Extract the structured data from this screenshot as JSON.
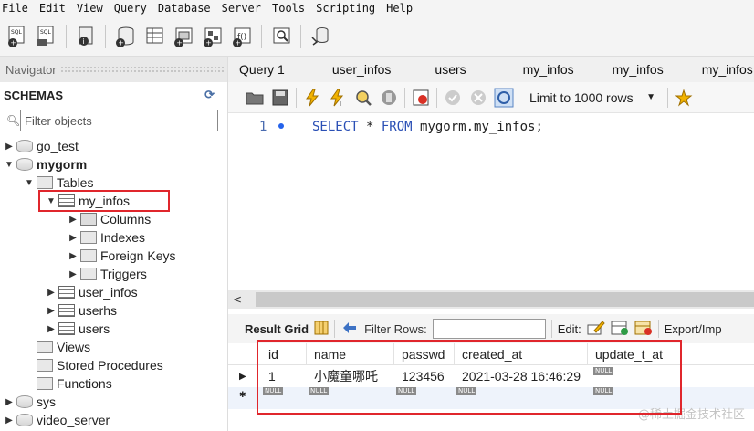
{
  "menu": [
    "File",
    "Edit",
    "View",
    "Query",
    "Database",
    "Server",
    "Tools",
    "Scripting",
    "Help"
  ],
  "toolbar_icons": [
    "new-sql-tab-icon",
    "open-sql-file-icon",
    "info-icon",
    "create-schema-icon",
    "create-table-icon",
    "create-view-icon",
    "create-procedure-icon",
    "create-function-icon",
    "search-table-data-icon",
    "reconnect-icon"
  ],
  "navigator": {
    "title": "Navigator",
    "schemas_label": "SCHEMAS",
    "filter_placeholder": "Filter objects",
    "tree": {
      "go_test": "go_test",
      "mygorm": "mygorm",
      "tables": "Tables",
      "my_infos": "my_infos",
      "columns": "Columns",
      "indexes": "Indexes",
      "foreign_keys": "Foreign Keys",
      "triggers": "Triggers",
      "user_infos": "user_infos",
      "userhs": "userhs",
      "users": "users",
      "views": "Views",
      "stored_procedures": "Stored Procedures",
      "functions": "Functions",
      "sys": "sys",
      "video_server": "video_server"
    }
  },
  "tabs": [
    "Query 1",
    "user_infos",
    "users",
    "my_infos",
    "my_infos",
    "my_infos"
  ],
  "editor": {
    "limit_label": "Limit to 1000 rows",
    "line_number": "1",
    "query_keyword_select": "SELECT",
    "query_star": " * ",
    "query_keyword_from": "FROM",
    "query_rest": " mygorm.my_infos;"
  },
  "result_toolbar": {
    "result_grid_label": "Result Grid",
    "filter_rows_label": "Filter Rows:",
    "edit_label": "Edit:",
    "export_label": "Export/Imp"
  },
  "result_grid": {
    "columns": [
      "id",
      "name",
      "passwd",
      "created_at",
      "update_t_at"
    ],
    "row1": {
      "id": "1",
      "name": "小魔童哪吒",
      "passwd": "123456",
      "created_at": "2021-03-28 16:46:29",
      "update_t_at": "NULL"
    },
    "null_label": "NULL"
  },
  "watermark": "@稀土掘金技术社区",
  "colors": {
    "highlight": "#e0262c",
    "keyword": "#2a4fb5"
  }
}
